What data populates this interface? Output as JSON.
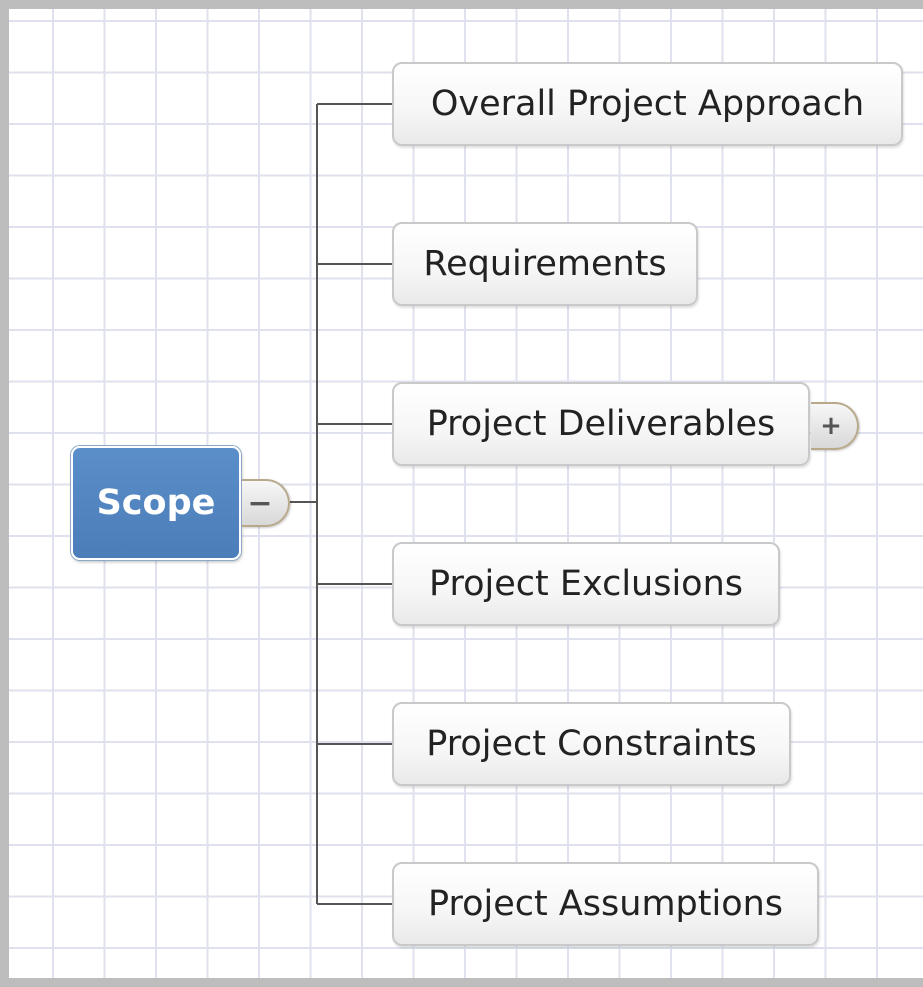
{
  "mindmap": {
    "root": {
      "label": "Scope",
      "color": "#4f82bd",
      "toggle_symbol": "−"
    },
    "children": [
      {
        "label": "Overall Project Approach"
      },
      {
        "label": "Requirements"
      },
      {
        "label": "Project Deliverables",
        "collapsed": true,
        "toggle_symbol": "+"
      },
      {
        "label": "Project Exclusions"
      },
      {
        "label": "Project Constraints"
      },
      {
        "label": "Project Assumptions"
      }
    ]
  }
}
